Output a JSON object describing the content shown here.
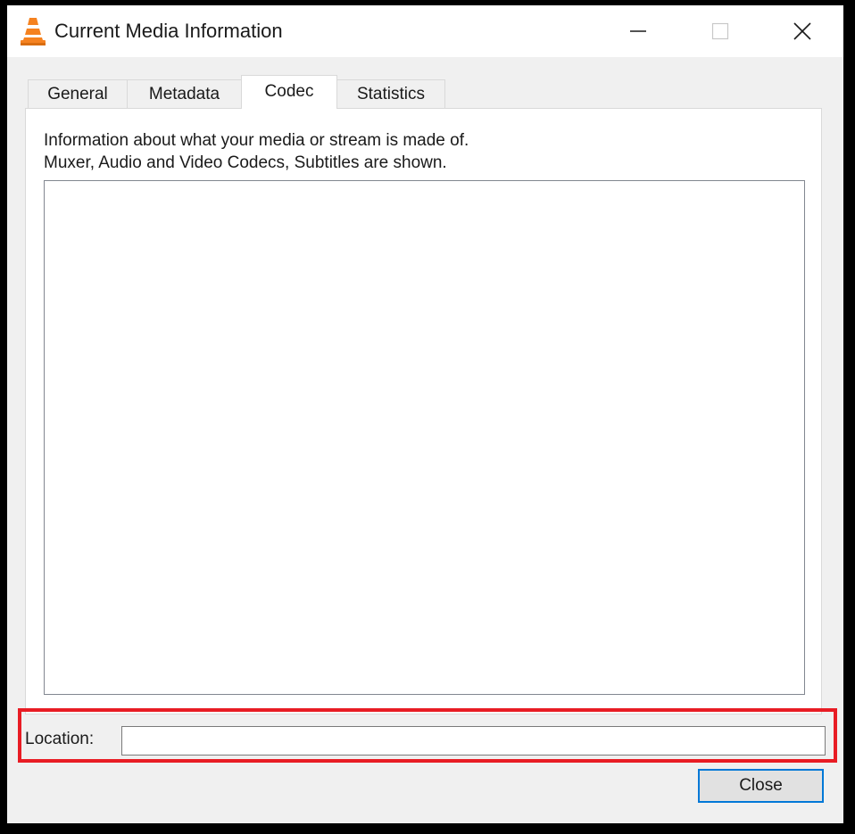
{
  "window": {
    "title": "Current Media Information",
    "icon": "vlc-cone-icon"
  },
  "tabs": [
    {
      "label": "General",
      "active": false
    },
    {
      "label": "Metadata",
      "active": false
    },
    {
      "label": "Codec",
      "active": true
    },
    {
      "label": "Statistics",
      "active": false
    }
  ],
  "codec": {
    "description_line1": "Information about what your media or stream is made of.",
    "description_line2": "Muxer, Audio and Video Codecs, Subtitles are shown."
  },
  "location": {
    "label": "Location:",
    "value": ""
  },
  "buttons": {
    "close_label": "Close"
  },
  "colors": {
    "highlight": "#e81c24",
    "focus_border": "#0078d7",
    "vlc_orange": "#f58220"
  }
}
